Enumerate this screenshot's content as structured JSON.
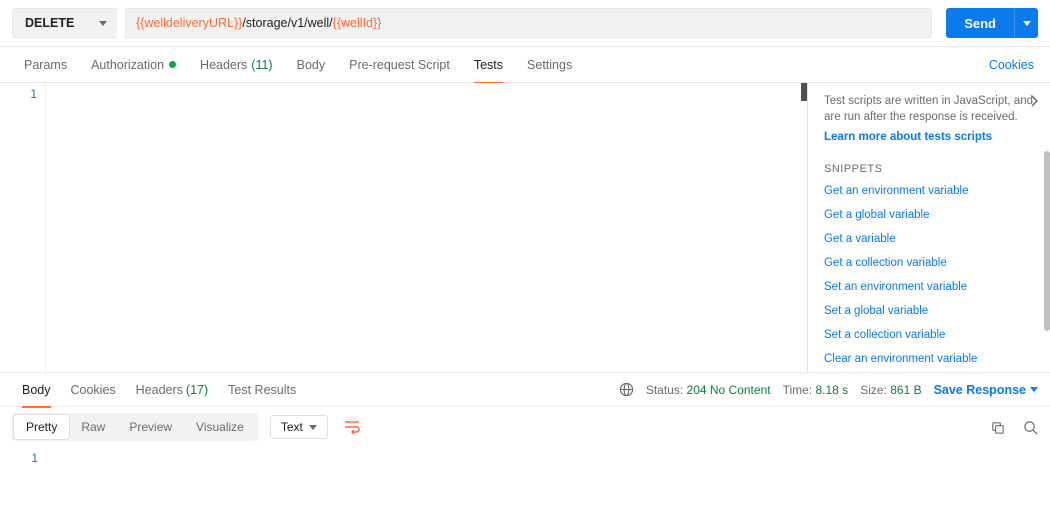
{
  "request": {
    "method": "DELETE",
    "url_parts": {
      "var1": "{{welldeliveryURL}}",
      "mid": "/storage/v1/well/",
      "var2": "{{wellId}}"
    },
    "send_label": "Send"
  },
  "tabs": {
    "params": "Params",
    "authorization": "Authorization",
    "headers": "Headers",
    "headers_count": "(11)",
    "body": "Body",
    "prerequest": "Pre-request Script",
    "tests": "Tests",
    "settings": "Settings",
    "cookies": "Cookies"
  },
  "editor": {
    "line_no": "1"
  },
  "snippets": {
    "desc": "Test scripts are written in JavaScript, and are run after the response is received.",
    "learn": "Learn more about tests scripts",
    "header": "SNIPPETS",
    "items": [
      "Get an environment variable",
      "Get a global variable",
      "Get a variable",
      "Get a collection variable",
      "Set an environment variable",
      "Set a global variable",
      "Set a collection variable",
      "Clear an environment variable"
    ]
  },
  "response_tabs": {
    "body": "Body",
    "cookies": "Cookies",
    "headers": "Headers",
    "headers_count": "(17)",
    "test_results": "Test Results"
  },
  "response_meta": {
    "status_label": "Status:",
    "status_value": "204 No Content",
    "time_label": "Time:",
    "time_value": "8.18 s",
    "size_label": "Size:",
    "size_value": "861 B",
    "save_label": "Save Response"
  },
  "toolbar": {
    "pretty": "Pretty",
    "raw": "Raw",
    "preview": "Preview",
    "visualize": "Visualize",
    "lang": "Text"
  },
  "response_editor": {
    "line_no": "1"
  }
}
